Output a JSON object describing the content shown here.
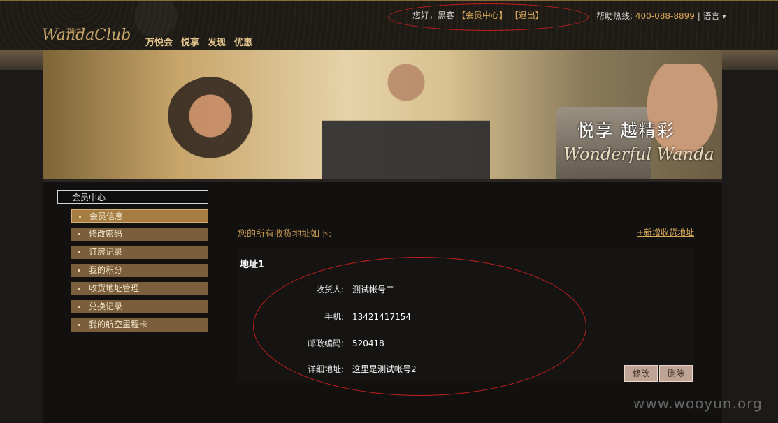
{
  "header": {
    "logo": "WandaClub",
    "logo_sub": "万悦会",
    "nav": [
      "万悦会",
      "悦享",
      "发现",
      "优惠"
    ],
    "greeting_prefix": "您好，",
    "user": "黑客",
    "member_center": "【会员中心】",
    "logout": "【退出】",
    "hotline_label": "帮助热线: ",
    "hotline_number": "400-088-8899",
    "language": "| 语言"
  },
  "banner": {
    "slogan": "悦享 越精彩",
    "slogan_en": "Wonderful Wanda"
  },
  "sidebar": {
    "title": "会员中心",
    "items": [
      {
        "label": "会员信息"
      },
      {
        "label": "修改密码"
      },
      {
        "label": "订房记录"
      },
      {
        "label": "我的积分"
      },
      {
        "label": "收货地址管理"
      },
      {
        "label": "兑换记录"
      },
      {
        "label": "我的航空里程卡"
      }
    ]
  },
  "main": {
    "intro": "您的所有收货地址如下:",
    "add_link": "+新增收货地址",
    "address": {
      "title": "地址1",
      "fields": [
        {
          "label": "收货人:",
          "value": "测试帐号二"
        },
        {
          "label": "手机:",
          "value": "13421417154"
        },
        {
          "label": "邮政编码:",
          "value": "520418"
        },
        {
          "label": "详细地址:",
          "value": "这里是测试帐号2"
        }
      ],
      "edit": "修改",
      "delete": "删除"
    }
  },
  "watermark": "www.wooyun.org",
  "colors": {
    "accent": "#d7a85a",
    "menu_bg": "#7b5e3c",
    "annotation": "#c21f1f"
  }
}
